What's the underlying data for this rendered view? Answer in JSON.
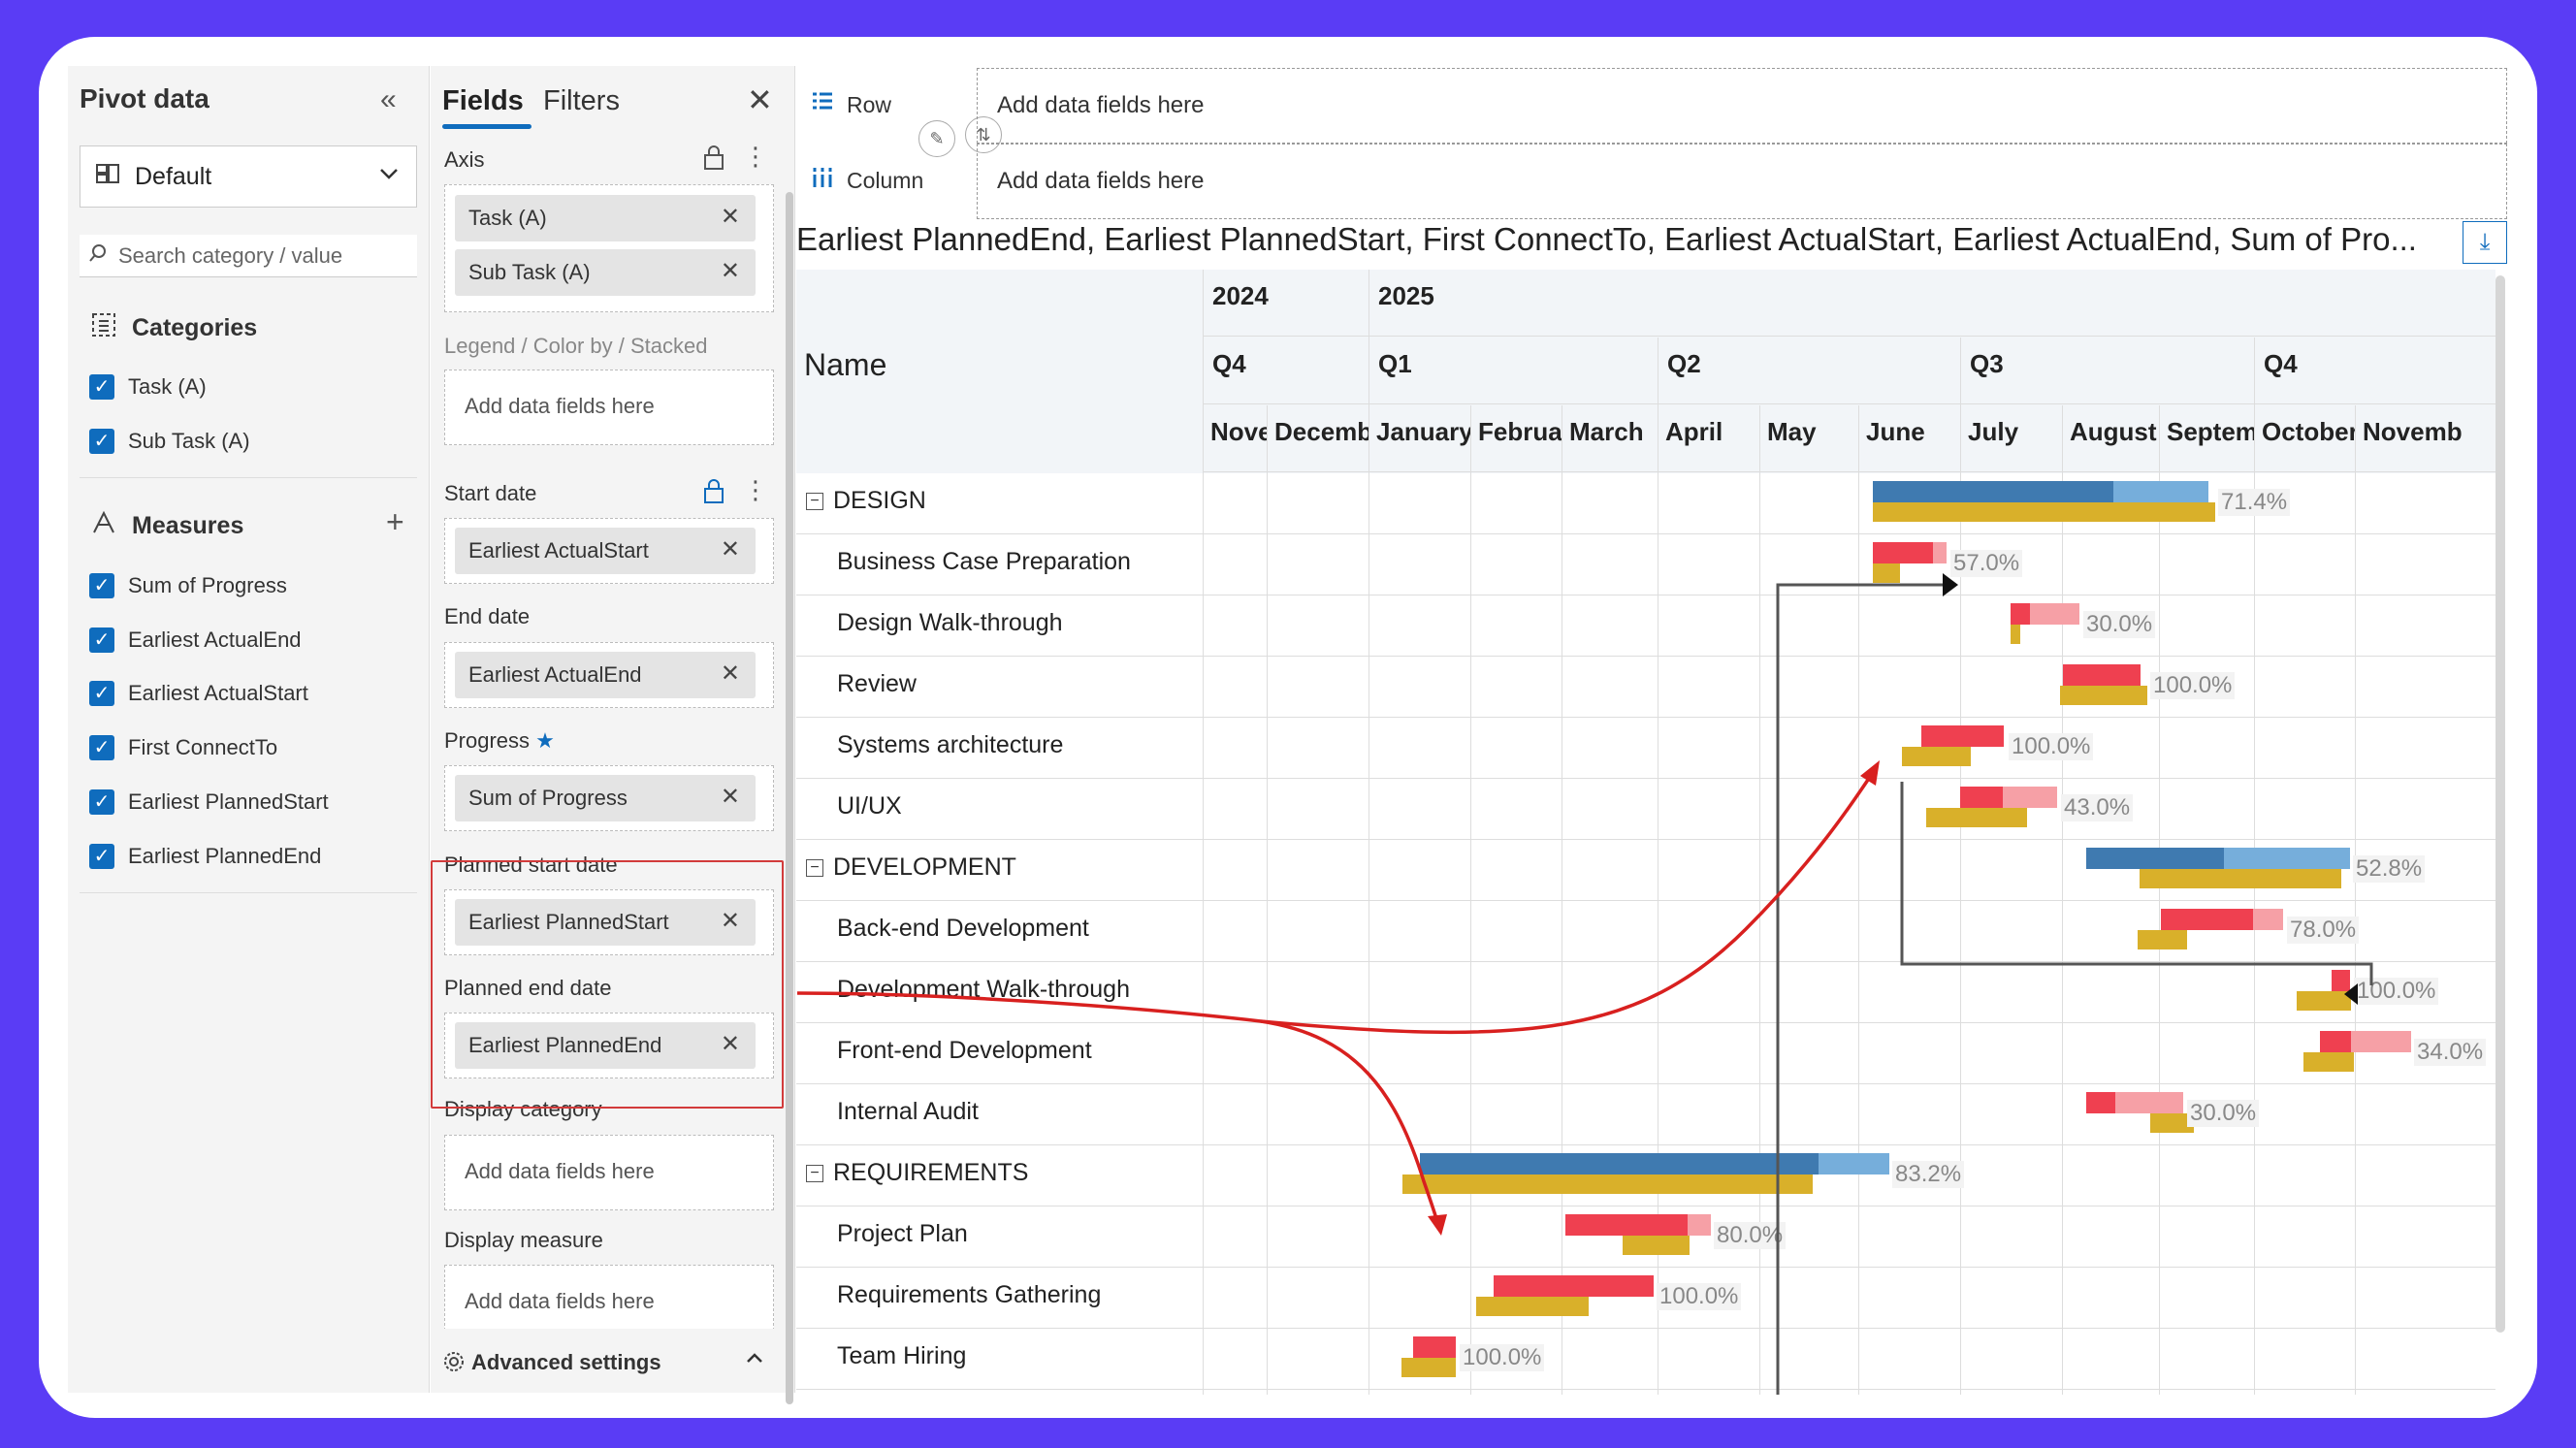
{
  "pivot": {
    "title": "Pivot data",
    "report": "Default",
    "search_placeholder": "Search category / value",
    "categories_label": "Categories",
    "categories": [
      "Task (A)",
      "Sub Task (A)"
    ],
    "measures_label": "Measures",
    "measures": [
      "Sum of Progress",
      "Earliest ActualEnd",
      "Earliest ActualStart",
      "First ConnectTo",
      "Earliest PlannedStart",
      "Earliest PlannedEnd"
    ],
    "check_glyph": "✓"
  },
  "fields": {
    "tab_fields": "Fields",
    "tab_filters": "Filters",
    "axis_label": "Axis",
    "axis_chips": [
      "Task (A)",
      "Sub Task (A)"
    ],
    "legend_label": "Legend / Color by / Stacked",
    "placeholder": "Add data fields here",
    "start_label": "Start date",
    "start_chip": "Earliest ActualStart",
    "end_label": "End date",
    "end_chip": "Earliest ActualEnd",
    "progress_label": "Progress",
    "progress_chip": "Sum of Progress",
    "planned_start_label": "Planned start date",
    "planned_start_chip": "Earliest PlannedStart",
    "planned_end_label": "Planned end date",
    "planned_end_chip": "Earliest PlannedEnd",
    "display_category_label": "Display category",
    "display_measure_label": "Display measure",
    "advanced_label": "Advanced settings"
  },
  "main": {
    "row_label": "Row",
    "column_label": "Column",
    "placeholder": "Add data fields here",
    "title": "Earliest PlannedEnd, Earliest PlannedStart, First ConnectTo, Earliest ActualStart, Earliest ActualEnd, Sum of Pro...",
    "name_header": "Name"
  },
  "timeline": {
    "years": [
      "2024",
      "2025"
    ],
    "quarters": [
      "Q4",
      "Q1",
      "Q2",
      "Q3",
      "Q4"
    ],
    "months": [
      "Nove",
      "Decemb",
      "January",
      "Februa",
      "March",
      "April",
      "May",
      "June",
      "July",
      "August",
      "Septem",
      "October",
      "Novemb"
    ]
  },
  "rows": [
    {
      "name": "DESIGN",
      "group": true,
      "pct": "71.4%"
    },
    {
      "name": "Business Case Preparation",
      "group": false,
      "pct": "57.0%"
    },
    {
      "name": "Design Walk-through",
      "group": false,
      "pct": "30.0%"
    },
    {
      "name": "Review",
      "group": false,
      "pct": "100.0%"
    },
    {
      "name": "Systems architecture",
      "group": false,
      "pct": "100.0%"
    },
    {
      "name": "UI/UX",
      "group": false,
      "pct": "43.0%"
    },
    {
      "name": "DEVELOPMENT",
      "group": true,
      "pct": "52.8%"
    },
    {
      "name": "Back-end Development",
      "group": false,
      "pct": "78.0%"
    },
    {
      "name": "Development Walk-through",
      "group": false,
      "pct": "100.0%"
    },
    {
      "name": "Front-end Development",
      "group": false,
      "pct": "34.0%"
    },
    {
      "name": "Internal Audit",
      "group": false,
      "pct": "30.0%"
    },
    {
      "name": "REQUIREMENTS",
      "group": true,
      "pct": "83.2%"
    },
    {
      "name": "Project Plan",
      "group": false,
      "pct": "80.0%"
    },
    {
      "name": "Requirements Gathering",
      "group": false,
      "pct": "100.0%"
    },
    {
      "name": "Team Hiring",
      "group": false,
      "pct": "100.0%"
    }
  ],
  "colors": {
    "summary_done": "#3f7ab0",
    "summary_remaining": "#76aedb",
    "task_done": "#ef4050",
    "task_remaining": "#f6a0a6",
    "planned": "#d9b02a",
    "annotation": "#d8201f",
    "connector": "#555555"
  }
}
